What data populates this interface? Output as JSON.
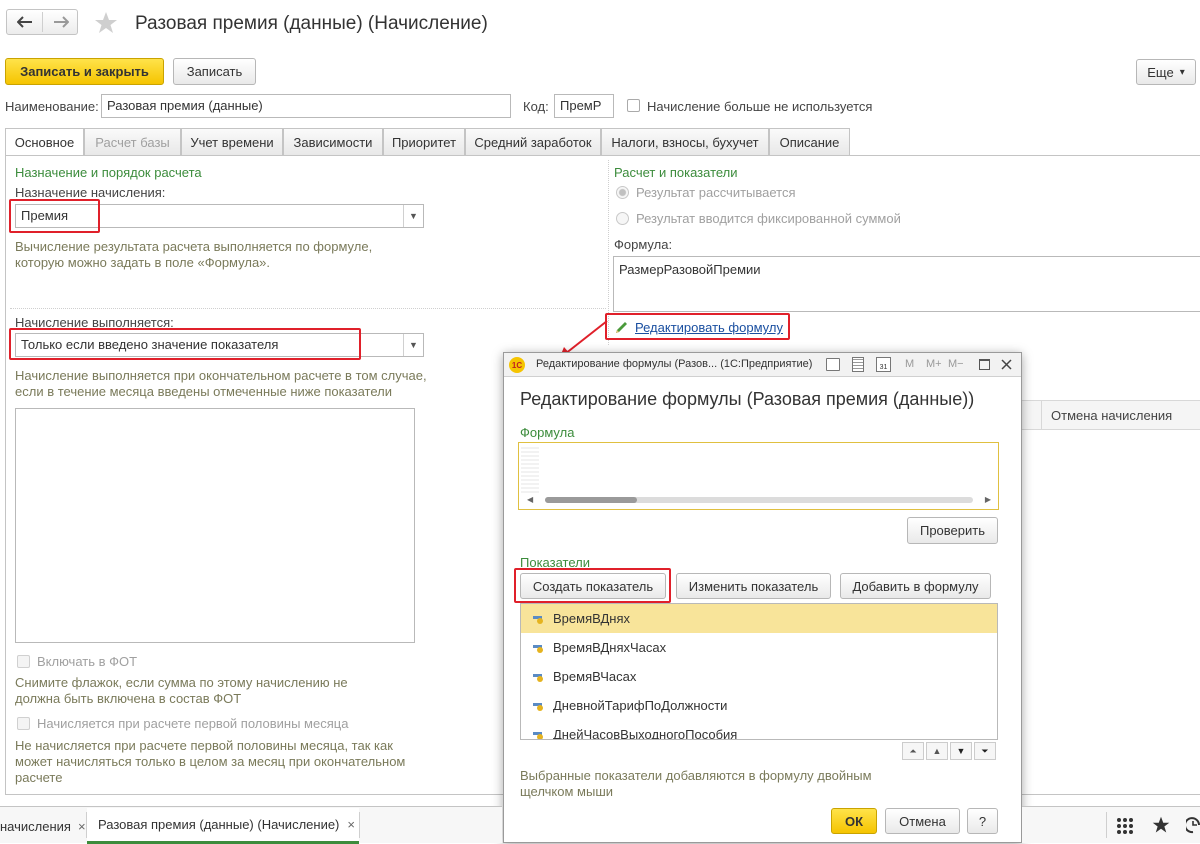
{
  "header": {
    "back_icon": "arrow-left-icon",
    "forward_icon": "arrow-right-icon",
    "favorite_icon": "star-icon",
    "title": "Разовая премия (данные) (Начисление)"
  },
  "toolbar": {
    "save_close_label": "Записать и закрыть",
    "save_label": "Записать",
    "more_label": "Еще",
    "more_arrow": "▾"
  },
  "fields": {
    "name_label": "Наименование:",
    "name_value": "Разовая премия (данные)",
    "code_label": "Код:",
    "code_value": "ПремР",
    "unused_label": "Начисление больше не используется"
  },
  "tabs": [
    {
      "label": "Основное",
      "state": "active"
    },
    {
      "label": "Расчет базы",
      "state": "disabled"
    },
    {
      "label": "Учет времени",
      "state": "normal"
    },
    {
      "label": "Зависимости",
      "state": "normal"
    },
    {
      "label": "Приоритет",
      "state": "normal"
    },
    {
      "label": "Средний заработок",
      "state": "normal"
    },
    {
      "label": "Налоги, взносы, бухучет",
      "state": "normal"
    },
    {
      "label": "Описание",
      "state": "normal"
    }
  ],
  "left": {
    "section_title": "Назначение и порядок расчета",
    "purpose_label": "Назначение начисления:",
    "purpose_value": "Премия",
    "purpose_hint": "Вычисление результата расчета выполняется по формуле, которую можно задать в поле «Формула».",
    "exec_label": "Начисление выполняется:",
    "exec_value": "Только если введено значение показателя",
    "exec_hint": "Начисление выполняется при окончательном расчете в том случае, если в течение месяца введены отмеченные ниже показатели",
    "fot_label": "Включать в ФОТ",
    "fot_hint": "Снимите флажок, если сумма по этому начислению не должна быть включена в состав ФОТ",
    "half_label": "Начисляется при расчете первой половины месяца",
    "half_hint": "Не начисляется при расчете первой половины месяца, так как может начисляться только в целом за месяц при окончательном расчете"
  },
  "right": {
    "section_title": "Расчет и показатели",
    "radio_calc": "Результат рассчитывается",
    "radio_fixed": "Результат вводится фиксированной суммой",
    "formula_label": "Формула:",
    "formula_value": "РазмерРазовойПремии",
    "edit_formula_link": "Редактировать формулу",
    "column_cancel": "Отмена начисления"
  },
  "dialog": {
    "window_title": "Редактирование формулы (Разов...  (1С:Предприятие)",
    "heading": "Редактирование формулы (Разовая премия (данные))",
    "formula_label": "Формула",
    "check_label": "Проверить",
    "indicators_label": "Показатели",
    "create_label": "Создать показатель",
    "change_label": "Изменить показатель",
    "add_label": "Добавить в формулу",
    "items": [
      "ВремяВДнях",
      "ВремяВДняхЧасах",
      "ВремяВЧасах",
      "ДневнойТарифПоДолжности",
      "ДнейЧасовВыходногоПособия"
    ],
    "hint": "Выбранные показатели добавляются в формулу двойным щелчком мыши",
    "ok_label": "ОК",
    "cancel_label": "Отмена",
    "help_label": "?",
    "logo_text": "1С",
    "tb_m": "M",
    "tb_mplus": "M+",
    "tb_mminus": "M−",
    "cal_day": "31"
  },
  "bottom": {
    "tab1": "начисления",
    "tab2": "Разовая премия (данные) (Начисление)",
    "close_glyph": "×"
  },
  "colors": {
    "accent_yellow": "#f5c400",
    "section_green": "#3c8c3c",
    "highlight_red": "#e0202a",
    "selected_row": "#f8e49a",
    "link_blue": "#1a4fa0"
  }
}
